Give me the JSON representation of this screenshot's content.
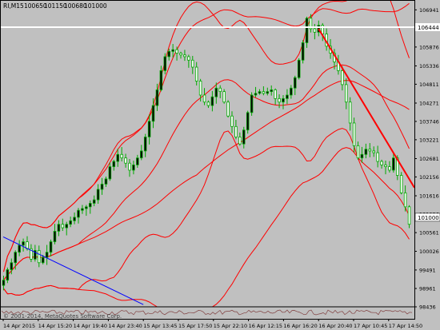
{
  "header": {
    "symbol": "RI,M15",
    "ohlc": [
      "100650",
      "101150",
      "100680",
      "101000"
    ]
  },
  "watermark": "© 2001-2014, MetaQuotes Software Corp.",
  "level_label": "106444",
  "last_price_label": "101000",
  "colors": {
    "background": "#c0c0c0",
    "candle": "#00aa00",
    "bands": "#ff0000",
    "trendline_down": "#ff0000",
    "trendline_blue": "#0000ff",
    "level_line": "#ffffff",
    "price_badge": "#ffffff",
    "axis_text": "#000000"
  },
  "chart_data": {
    "type": "candlestick",
    "symbol": "RI",
    "timeframe": "M15",
    "ylim": [
      98436,
      107200
    ],
    "y_ticks": [
      "106941",
      "106406",
      "105876",
      "105336",
      "104811",
      "104271",
      "103746",
      "103221",
      "102681",
      "102156",
      "101616",
      "101086",
      "100561",
      "100026",
      "99491",
      "98961",
      "98436"
    ],
    "x_ticks": [
      "14 Apr 2015",
      "14 Apr 15:20",
      "14 Apr 19:40",
      "14 Apr 23:40",
      "15 Apr 13:45",
      "15 Apr 17:50",
      "15 Apr 22:10",
      "16 Apr 12:15",
      "16 Apr 16:20",
      "16 Apr 20:40",
      "17 Apr 10:45",
      "17 Apr 14:50"
    ],
    "close_series": [
      99200,
      99500,
      99700,
      100000,
      100200,
      100300,
      100100,
      99800,
      100050,
      99700,
      99850,
      100000,
      100300,
      100600,
      100800,
      100700,
      100800,
      100900,
      101000,
      101200,
      101250,
      101300,
      101400,
      101500,
      101800,
      101950,
      102100,
      102450,
      102600,
      102800,
      102700,
      102550,
      102350,
      102500,
      102700,
      102900,
      103300,
      103750,
      104200,
      104650,
      105200,
      105600,
      105750,
      105800,
      105700,
      105650,
      105600,
      105500,
      105300,
      104900,
      104500,
      104300,
      104200,
      104450,
      104700,
      104600,
      104300,
      103900,
      103600,
      103300,
      103100,
      103500,
      104000,
      104500,
      104550,
      104600,
      104550,
      104600,
      104650,
      104400,
      104300,
      104400,
      104500,
      104700,
      105000,
      105500,
      106000,
      106700,
      106400,
      106300,
      106500,
      106250,
      105900,
      105700,
      105450,
      105200,
      104800,
      104300,
      103700,
      103050,
      102700,
      102800,
      102950,
      102900,
      102850,
      102600,
      102500,
      102450,
      102350,
      102700,
      102200,
      101700,
      101300,
      100800
    ],
    "candles_from_series": true,
    "indicators": [
      {
        "name": "Bollinger Bands (20)",
        "lines": [
          "upper",
          "middle",
          "lower"
        ]
      },
      {
        "name": "Bollinger Bands (50)",
        "lines": [
          "upper",
          "middle",
          "lower"
        ]
      }
    ],
    "horizontal_level": 106444,
    "last_price": 101000,
    "trendlines": [
      {
        "color": "red",
        "from": [
          "16 Apr 20:40",
          106400
        ],
        "to": [
          "17 Apr 16:00",
          101850
        ]
      },
      {
        "color": "blue",
        "from": [
          "14 Apr 2015",
          100440
        ],
        "to": [
          "15 Apr 13:45",
          98500
        ]
      }
    ],
    "grid": false
  }
}
